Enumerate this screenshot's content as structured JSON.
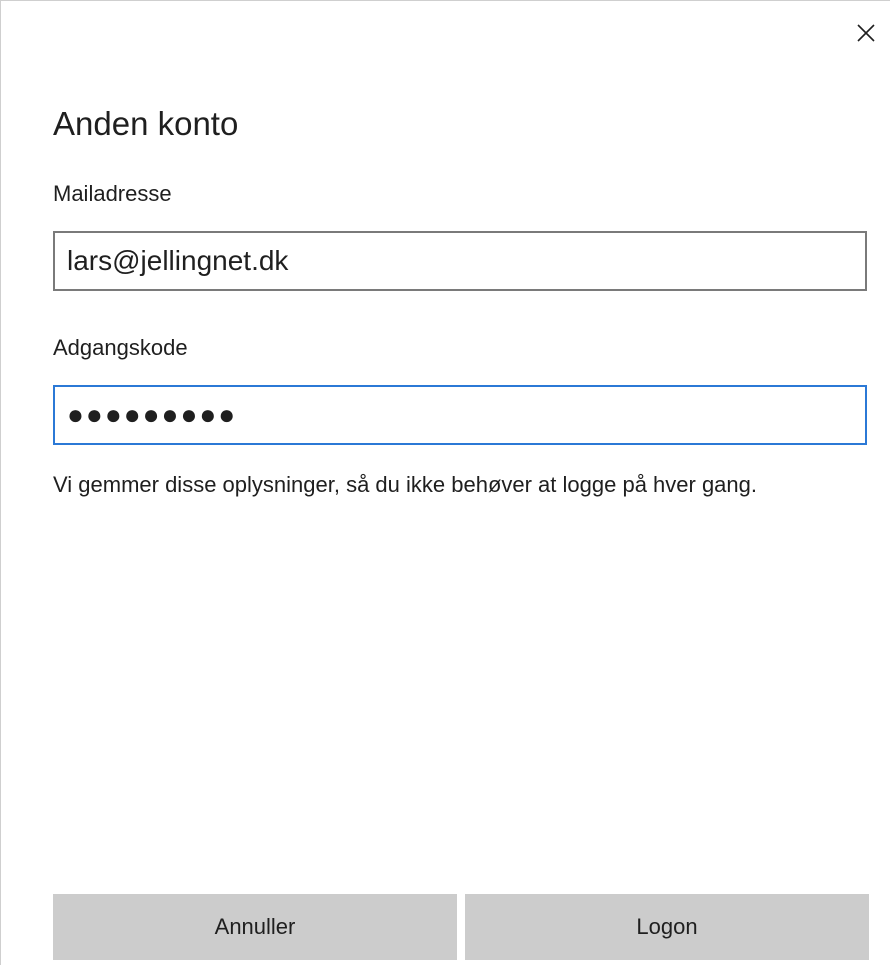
{
  "dialog": {
    "title": "Anden konto",
    "close_icon": "close-icon"
  },
  "email": {
    "label": "Mailadresse",
    "value": "lars@jellingnet.dk"
  },
  "password": {
    "label": "Adgangskode",
    "masked_value": "●●●●●●●●●"
  },
  "info": {
    "text": "Vi gemmer disse oplysninger, så du ikke behøver at logge på hver gang."
  },
  "buttons": {
    "cancel_label": "Annuller",
    "logon_label": "Logon"
  },
  "colors": {
    "focus_border": "#2b79d6",
    "input_border": "#7a7a7a",
    "button_bg": "#cccccc"
  }
}
